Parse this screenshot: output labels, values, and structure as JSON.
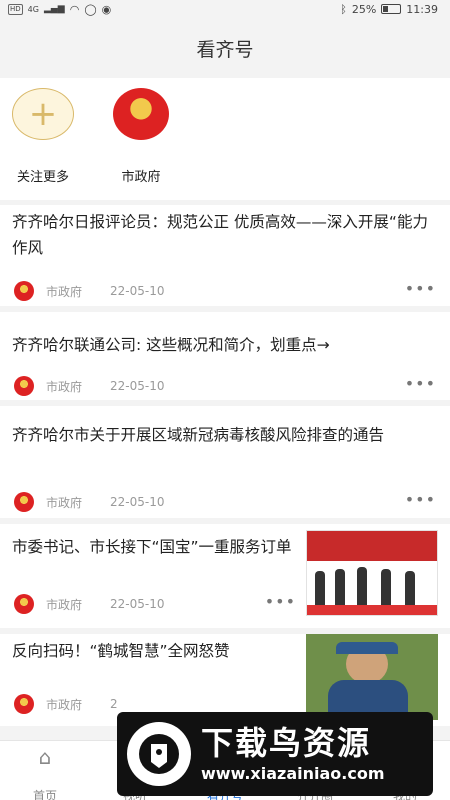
{
  "status_bar": {
    "hd": "HD",
    "network": "4G",
    "battery": "25%",
    "time": "11:39"
  },
  "header": {
    "title": "看齐号"
  },
  "follows": [
    {
      "label": "关注更多",
      "icon": "add-icon"
    },
    {
      "label": "市政府",
      "icon": "national-emblem-icon"
    }
  ],
  "articles": [
    {
      "title": "齐齐哈尔日报评论员：规范公正 优质高效——深入开展“能力作风",
      "source": "市政府",
      "date": "22-05-10"
    },
    {
      "title": "齐齐哈尔联通公司: 这些概况和简介，划重点→",
      "source": "市政府",
      "date": "22-05-10"
    },
    {
      "title": "齐齐哈尔市关于开展区域新冠病毒核酸风险排查的通告",
      "source": "市政府",
      "date": "22-05-10"
    },
    {
      "title": "市委书记、市长接下“国宝”一重服务订单",
      "source": "市政府",
      "date": "22-05-10"
    },
    {
      "title": "反向扫码！“鹤城智慧”全网怒赞",
      "source": "市政府",
      "date": "2"
    }
  ],
  "bottom_nav": [
    {
      "label": "首页",
      "icon": "home-icon"
    },
    {
      "label": "视听",
      "icon": "video-icon"
    },
    {
      "label": "看齐号",
      "icon": "kanqi-icon",
      "active": true
    },
    {
      "label": "齐齐圈",
      "icon": "circle-icon"
    },
    {
      "label": "我的",
      "icon": "user-icon"
    }
  ],
  "watermark": {
    "title": "下载鸟资源",
    "url": "www.xiazainiao.com"
  },
  "colors": {
    "accent": "#1e6fd9",
    "gold": "#d9b96a",
    "emblem_red": "#dd2222"
  }
}
